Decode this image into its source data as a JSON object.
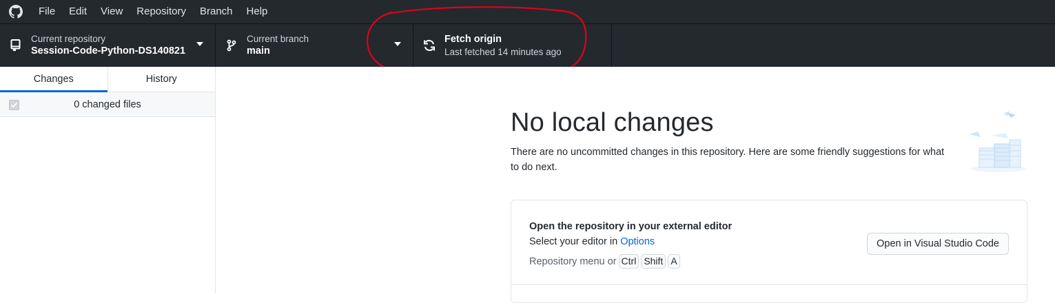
{
  "menu": {
    "items": [
      "File",
      "Edit",
      "View",
      "Repository",
      "Branch",
      "Help"
    ]
  },
  "toolbar": {
    "repository": {
      "label": "Current repository",
      "value": "Session-Code-Python-DS140821"
    },
    "branch": {
      "label": "Current branch",
      "value": "main"
    },
    "fetch": {
      "label": "Fetch origin",
      "value": "Last fetched 14 minutes ago"
    }
  },
  "sidebar": {
    "tabs": {
      "changes": "Changes",
      "history": "History"
    },
    "changed_files": "0 changed files"
  },
  "main": {
    "headline": "No local changes",
    "subtext": "There are no uncommitted changes in this repository. Here are some friendly suggestions for what to do next.",
    "card": {
      "title": "Open the repository in your external editor",
      "desc_prefix": "Select your editor in ",
      "desc_link": "Options",
      "shortcut_prefix": "Repository menu or",
      "keys": [
        "Ctrl",
        "Shift",
        "A"
      ],
      "button": "Open in Visual Studio Code"
    }
  },
  "colors": {
    "chrome": "#24292e",
    "accent": "#0366d6",
    "annotation": "#e3001b"
  },
  "icons": [
    "github-logo-icon",
    "repo-icon",
    "branch-icon",
    "sync-icon",
    "chevron-down-icon",
    "checkbox-icon"
  ]
}
